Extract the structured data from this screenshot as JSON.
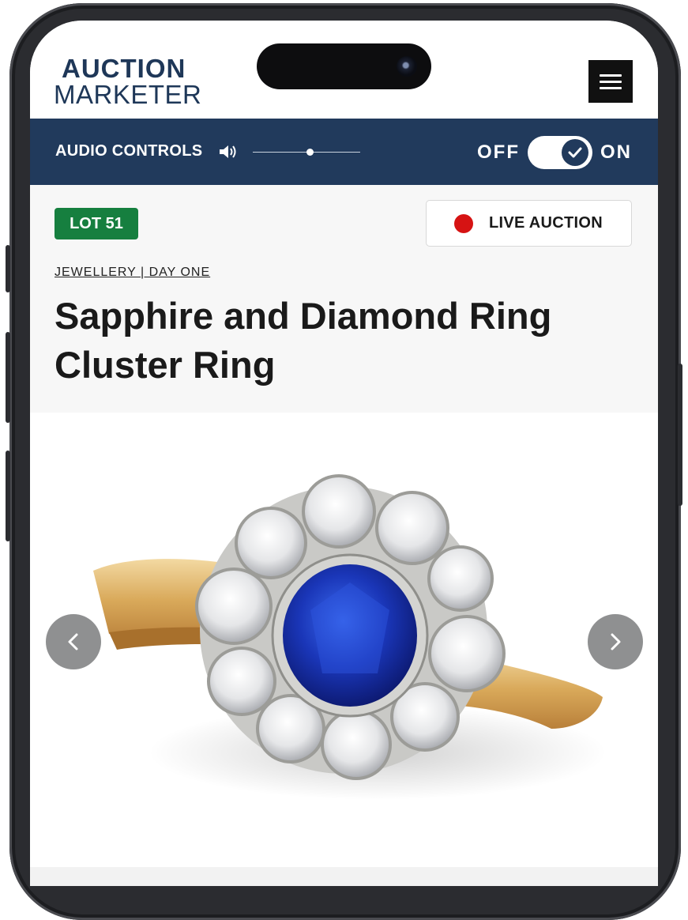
{
  "header": {
    "logo_line1": "AUCTION",
    "logo_line2": "MARKETER",
    "menu_icon": "hamburger-menu-icon"
  },
  "audio_bar": {
    "label": "AUDIO CONTROLS",
    "speaker_icon": "speaker-icon",
    "volume_level": 0.53,
    "off_label": "OFF",
    "on_label": "ON",
    "toggle_state": "on"
  },
  "lot": {
    "badge": "LOT 51",
    "live_label": "LIVE AUCTION",
    "breadcrumb": "JEWELLERY | DAY ONE",
    "title": "Sapphire and Diamond Ring Cluster Ring"
  },
  "gallery": {
    "prev_icon": "chevron-left-icon",
    "next_icon": "chevron-right-icon"
  },
  "colors": {
    "brand_navy": "#213a5c",
    "lot_green": "#167f3f",
    "live_red": "#d61313"
  }
}
